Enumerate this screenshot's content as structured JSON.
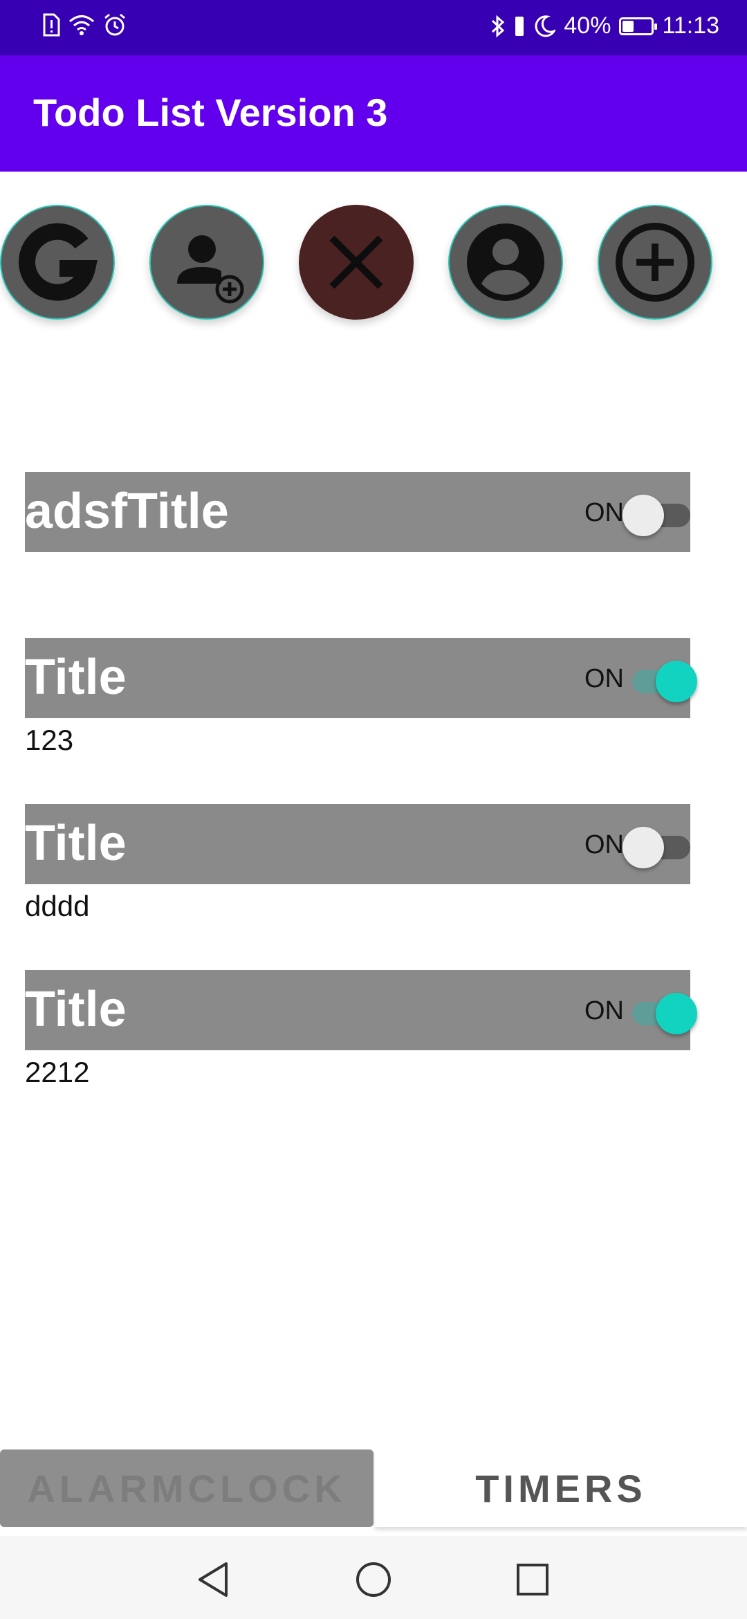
{
  "status_bar": {
    "battery_percent": "40%",
    "battery_level": 0.4,
    "time": "11:13",
    "left_icons": [
      "sim-alert-icon",
      "wifi-icon",
      "alarm-icon"
    ],
    "right_icons": [
      "bluetooth-icon",
      "vibrate-icon",
      "moon-icon",
      "battery-icon"
    ]
  },
  "app_bar": {
    "title": "Todo List Version 3"
  },
  "fab_buttons": [
    {
      "name": "google-icon",
      "style": "gray"
    },
    {
      "name": "add-user-icon",
      "style": "gray"
    },
    {
      "name": "close-icon",
      "style": "dark-red"
    },
    {
      "name": "account-icon",
      "style": "gray"
    },
    {
      "name": "add-circle-icon",
      "style": "gray"
    }
  ],
  "todos": [
    {
      "title": "adsfTitle",
      "switch_label": "ON",
      "checked": false,
      "subtitle": ""
    },
    {
      "title": "Title",
      "switch_label": "ON",
      "checked": true,
      "subtitle": "123"
    },
    {
      "title": "Title",
      "switch_label": "ON",
      "checked": false,
      "subtitle": "dddd"
    },
    {
      "title": "Title",
      "switch_label": "ON",
      "checked": true,
      "subtitle": "2212"
    }
  ],
  "tabs": {
    "alarm_label": "ALARMCLOCK",
    "timers_label": "TIMERS",
    "selected": "TIMERS"
  },
  "nav_bar": {
    "icons": [
      "back-icon",
      "home-icon",
      "recents-icon"
    ]
  },
  "colors": {
    "status_bar": "#3700b3",
    "app_bar": "#6200ee",
    "card": "#8a8a8a",
    "switch_on": "#12d3c0"
  }
}
